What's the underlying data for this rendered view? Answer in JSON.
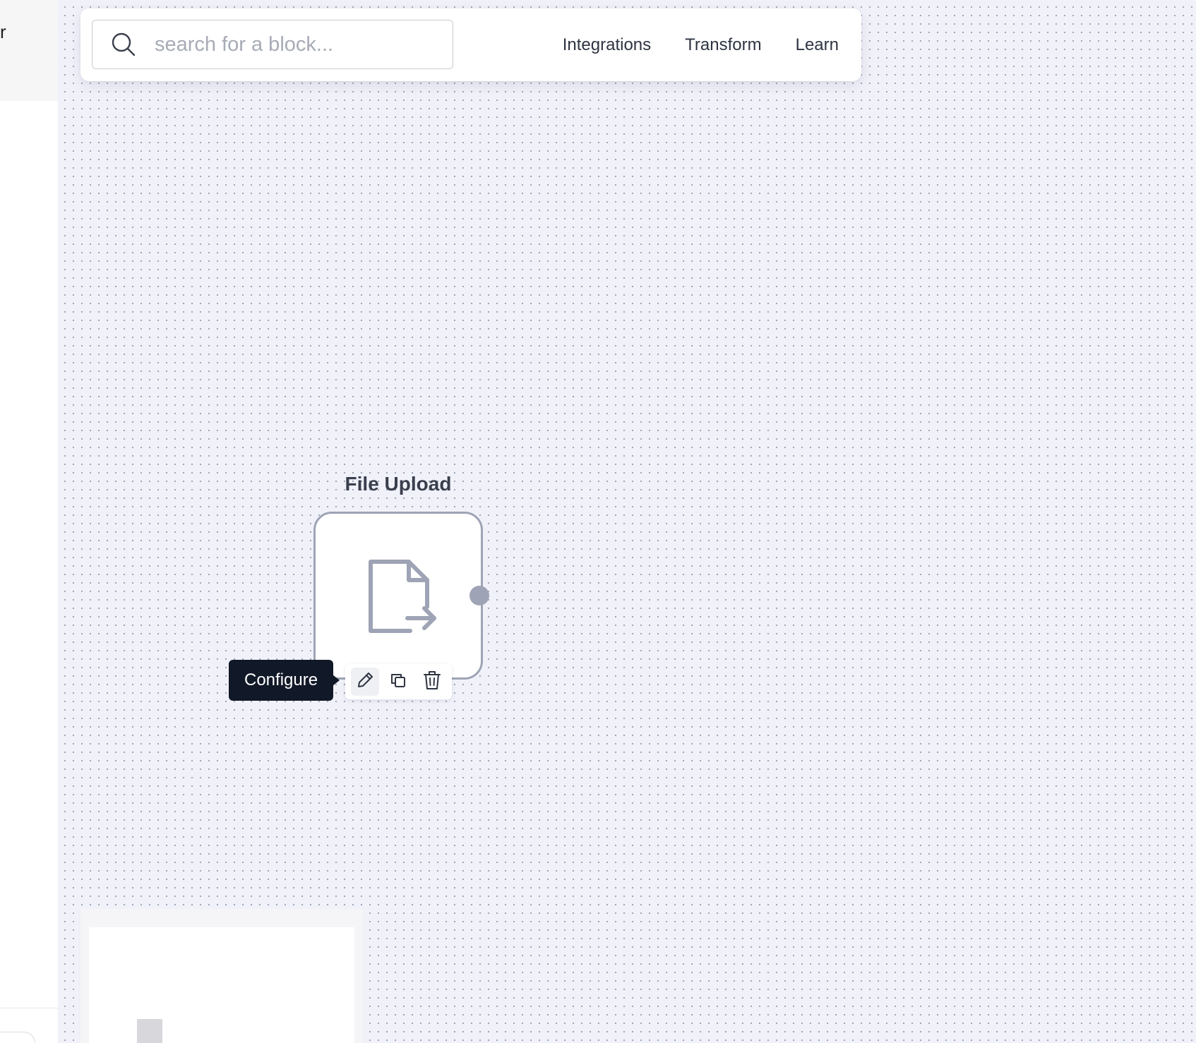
{
  "sidebar": {
    "partial_text": "r"
  },
  "search": {
    "placeholder": "search for a block...",
    "value": "",
    "icon": "search-icon"
  },
  "nav": {
    "items": [
      {
        "label": "Integrations"
      },
      {
        "label": "Transform"
      },
      {
        "label": "Learn"
      }
    ]
  },
  "block": {
    "label": "File Upload",
    "icon": "file-export-icon"
  },
  "actions": {
    "tooltip": "Configure",
    "items": [
      {
        "icon": "pencil-icon",
        "name": "Configure"
      },
      {
        "icon": "copy-icon",
        "name": "Duplicate"
      },
      {
        "icon": "trash-icon",
        "name": "Delete"
      }
    ]
  },
  "colors": {
    "canvas": "#f1f1fa",
    "node_border": "#9ea4b5",
    "tooltip_bg": "#111827"
  }
}
